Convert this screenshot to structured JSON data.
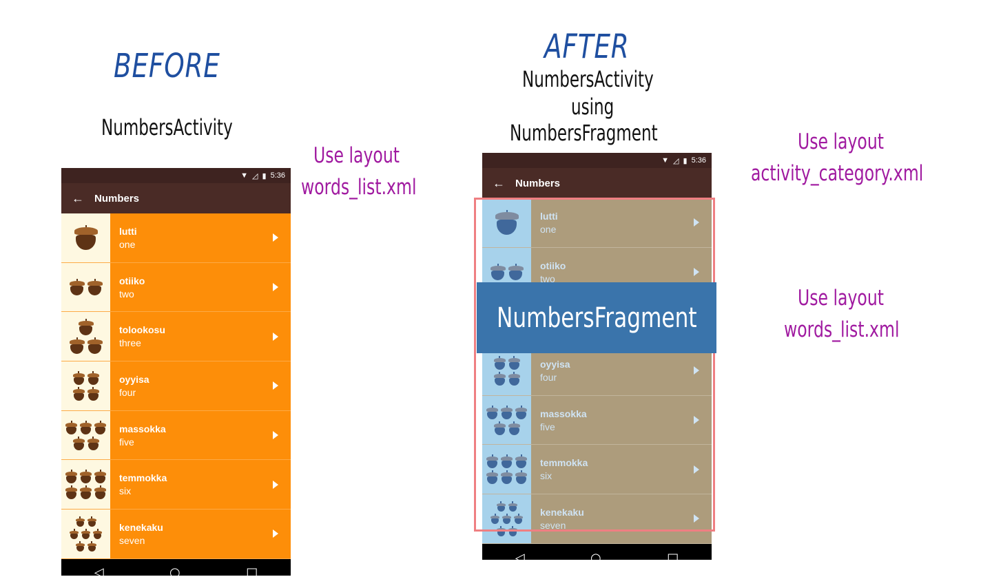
{
  "before": {
    "heading": "BEFORE",
    "caption": "NumbersActivity",
    "note": [
      "Use layout",
      "words_list.xml"
    ]
  },
  "after": {
    "heading": "AFTER",
    "caption": [
      "NumbersActivity",
      "using",
      "NumbersFragment"
    ],
    "note_top": [
      "Use layout",
      "activity_category.xml"
    ],
    "note_bottom": [
      "Use layout",
      "words_list.xml"
    ],
    "fragment_label": "NumbersFragment"
  },
  "phone": {
    "time": "5:36",
    "title": "Numbers",
    "icons": {
      "back": "arrow-left-icon",
      "wifi": "wifi-icon",
      "signal": "no-signal-icon",
      "battery": "battery-icon",
      "play": "play-icon"
    },
    "nav": [
      "back-triangle-icon",
      "home-circle-icon",
      "recents-square-icon"
    ]
  },
  "before_words": [
    {
      "miwok": "lutti",
      "english": "one"
    },
    {
      "miwok": "otiiko",
      "english": "two"
    },
    {
      "miwok": "tolookosu",
      "english": "three"
    },
    {
      "miwok": "oyyisa",
      "english": "four"
    },
    {
      "miwok": "massokka",
      "english": "five"
    },
    {
      "miwok": "temmokka",
      "english": "six"
    },
    {
      "miwok": "kenekaku",
      "english": "seven"
    }
  ],
  "after_words": [
    {
      "miwok": "lutti",
      "english": "one"
    },
    {
      "miwok": "otiiko",
      "english": "two"
    },
    {
      "miwok": "",
      "english": ""
    },
    {
      "miwok": "oyyisa",
      "english": "four"
    },
    {
      "miwok": "massokka",
      "english": "five"
    },
    {
      "miwok": "temmokka",
      "english": "six"
    },
    {
      "miwok": "kenekaku",
      "english": "seven"
    }
  ],
  "colors": {
    "before_row": "#fd8e09",
    "after_row": "#ad9c7c",
    "app_bar": "#4a2b26",
    "fragment_blue": "#3a74ab",
    "frame_red": "#ef7f82"
  }
}
